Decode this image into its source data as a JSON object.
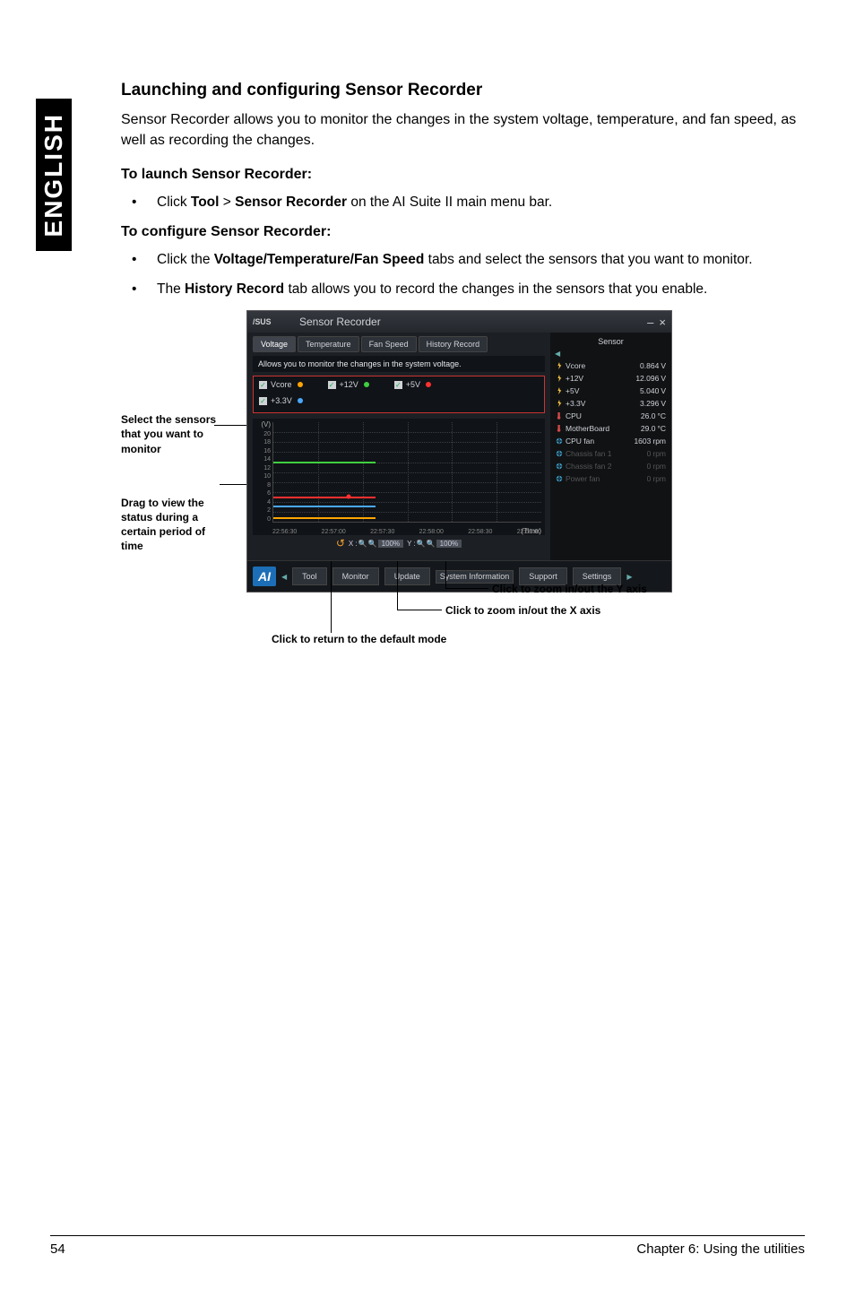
{
  "side_label": "ENGLISH",
  "heading": "Launching and configuring Sensor Recorder",
  "intro": "Sensor Recorder allows you to monitor the changes in the system voltage, temperature, and fan speed, as well as recording the changes.",
  "launch_heading": "To launch Sensor Recorder:",
  "launch_item_prefix": "Click ",
  "launch_item_bold1": "Tool",
  "launch_item_mid": " > ",
  "launch_item_bold2": "Sensor Recorder",
  "launch_item_suffix": " on the AI Suite II main menu bar.",
  "config_heading": "To configure Sensor Recorder:",
  "config_item1_prefix": "Click the ",
  "config_item1_bold": "Voltage/Temperature/Fan Speed",
  "config_item1_suffix": " tabs and select the sensors that you want to monitor.",
  "config_item2_prefix": "The ",
  "config_item2_bold": "History Record",
  "config_item2_suffix": " tab allows you to record the changes in the sensors that you enable.",
  "callout1": "Select the sensors that you want to monitor",
  "callout2": "Drag to view the status during a certain period of time",
  "uc_y": "Click to zoom in/out the Y axis",
  "uc_x": "Click to zoom in/out the X axis",
  "uc_reset": "Click to return to the default mode",
  "app": {
    "title": "Sensor Recorder",
    "tabs": {
      "voltage": "Voltage",
      "temperature": "Temperature",
      "fan": "Fan Speed",
      "history": "History Record"
    },
    "desc": "Allows you to monitor the changes in the system voltage.",
    "chk": {
      "vcore": "Vcore",
      "p12v": "+12V",
      "p5v": "+5V",
      "p33v": "+3.3V"
    },
    "yunit": "(V)",
    "timelabel": "(Time)",
    "zoom": {
      "xlabel": "X :",
      "ylabel": "Y :",
      "pct": "100%"
    },
    "bottom": {
      "tool": "Tool",
      "monitor": "Monitor",
      "update": "Update",
      "sysinfo": "System Information",
      "support": "Support",
      "settings": "Settings"
    },
    "sensor_hdr": "Sensor",
    "sensors": [
      {
        "name": "Vcore",
        "val": "0.864",
        "unit": "V",
        "type": "volt",
        "dim": false
      },
      {
        "name": "+12V",
        "val": "12.096",
        "unit": "V",
        "type": "volt",
        "dim": false
      },
      {
        "name": "+5V",
        "val": "5.040",
        "unit": "V",
        "type": "volt",
        "dim": false
      },
      {
        "name": "+3.3V",
        "val": "3.296",
        "unit": "V",
        "type": "volt",
        "dim": false
      },
      {
        "name": "CPU",
        "val": "26.0",
        "unit": "°C",
        "type": "temp",
        "dim": false
      },
      {
        "name": "MotherBoard",
        "val": "29.0",
        "unit": "°C",
        "type": "temp",
        "dim": false
      },
      {
        "name": "CPU fan",
        "val": "1603",
        "unit": "rpm",
        "type": "fan",
        "dim": false
      },
      {
        "name": "Chassis fan 1",
        "val": "0",
        "unit": "rpm",
        "type": "fan",
        "dim": true
      },
      {
        "name": "Chassis fan 2",
        "val": "0",
        "unit": "rpm",
        "type": "fan",
        "dim": true
      },
      {
        "name": "Power fan",
        "val": "0",
        "unit": "rpm",
        "type": "fan",
        "dim": true
      }
    ]
  },
  "chart_data": {
    "type": "line",
    "title": "",
    "xlabel": "(Time)",
    "ylabel": "(V)",
    "ylim": [
      0,
      20
    ],
    "x_ticks": [
      "22:56:30",
      "22:57:00",
      "22:57:30",
      "22:58:00",
      "22:58:30",
      "22:59:00"
    ],
    "y_ticks": [
      0,
      2,
      4,
      6,
      8,
      10,
      12,
      14,
      16,
      18,
      20
    ],
    "series": [
      {
        "name": "Vcore",
        "color": "#ffa500",
        "values": [
          0.9,
          0.9,
          0.9,
          0.9,
          0.9,
          0.9
        ]
      },
      {
        "name": "+12V",
        "color": "#40cf40",
        "values": [
          12.1,
          12.1,
          12.1,
          12.1,
          12.1,
          12.1
        ]
      },
      {
        "name": "+5V",
        "color": "#ff3030",
        "values": [
          5.0,
          5.0,
          5.0,
          5.0,
          5.0,
          5.0
        ]
      },
      {
        "name": "+3.3V",
        "color": "#4aa8ff",
        "values": [
          3.3,
          3.3,
          3.3,
          3.3,
          3.3,
          3.3
        ]
      }
    ]
  },
  "footer": {
    "page": "54",
    "chapter": "Chapter 6: Using the utilities"
  }
}
